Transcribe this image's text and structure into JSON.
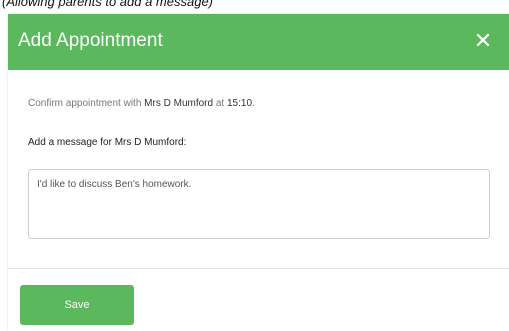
{
  "caption": "(Allowing parents to add a message)",
  "dialog": {
    "title": "Add Appointment",
    "close_icon": "close-icon",
    "colors": {
      "accent": "#5bb85d",
      "header_text": "#ffffff"
    }
  },
  "body": {
    "confirm_prefix": "Confirm appointment with ",
    "teacher_name": "Mrs D Mumford",
    "confirm_middle": " at ",
    "appointment_time": "15:10",
    "confirm_suffix": ".",
    "message_label": "Add a message for Mrs D Mumford:",
    "message_value": "I'd like to discuss Ben's homework."
  },
  "footer": {
    "save_label": "Save"
  }
}
